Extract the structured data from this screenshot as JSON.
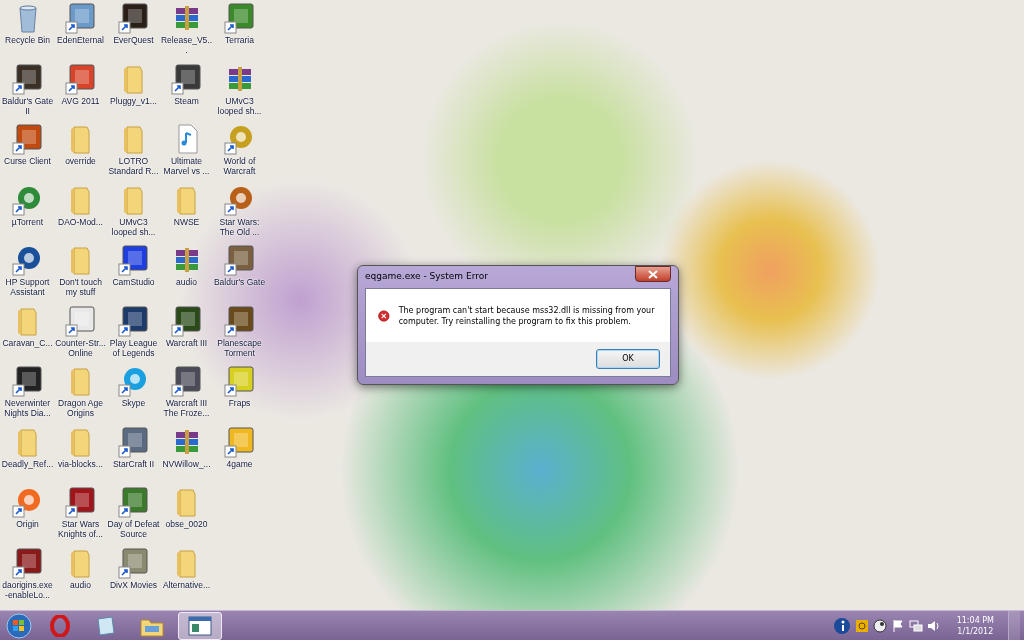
{
  "desktop_icons": [
    {
      "label": "Recycle Bin",
      "kind": "recycle",
      "shortcut": false,
      "color": "#9ab8d8"
    },
    {
      "label": "Baldur's Gate II",
      "kind": "app",
      "shortcut": true,
      "color": "#3a3026"
    },
    {
      "label": "Curse Client",
      "kind": "app",
      "shortcut": true,
      "color": "#c04a10"
    },
    {
      "label": "µTorrent",
      "kind": "round",
      "shortcut": true,
      "color": "#2e8b3a"
    },
    {
      "label": "HP Support Assistant",
      "kind": "round",
      "shortcut": true,
      "color": "#1a4f9a"
    },
    {
      "label": "Caravan_C...",
      "kind": "folder",
      "shortcut": false
    },
    {
      "label": "Neverwinter Nights Dia...",
      "kind": "app",
      "shortcut": true,
      "color": "#222222"
    },
    {
      "label": "Deadly_Ref...",
      "kind": "folder",
      "shortcut": false
    },
    {
      "label": "Origin",
      "kind": "round",
      "shortcut": true,
      "color": "#f06a22"
    },
    {
      "label": "daorigins.exe -enableLo...",
      "kind": "app",
      "shortcut": true,
      "color": "#8a1a1a"
    },
    {
      "label": "EdenEternal",
      "kind": "app",
      "shortcut": true,
      "color": "#6a9ac8"
    },
    {
      "label": "AVG 2011",
      "kind": "app",
      "shortcut": true,
      "color": "#d8442a"
    },
    {
      "label": "override",
      "kind": "folder",
      "shortcut": false
    },
    {
      "label": "DAO-Mod...",
      "kind": "folder",
      "shortcut": false
    },
    {
      "label": "Don't touch my stuff",
      "kind": "folder",
      "shortcut": false
    },
    {
      "label": "Counter-Str... Online",
      "kind": "app",
      "shortcut": true,
      "color": "#e8e8e8"
    },
    {
      "label": "Dragon Age Origins",
      "kind": "folder",
      "shortcut": false
    },
    {
      "label": "via-blocks...",
      "kind": "folder",
      "shortcut": false
    },
    {
      "label": "Star Wars Knights of...",
      "kind": "app",
      "shortcut": true,
      "color": "#a0141a"
    },
    {
      "label": "audio",
      "kind": "folder",
      "shortcut": false
    },
    {
      "label": "EverQuest",
      "kind": "app",
      "shortcut": true,
      "color": "#2a2018"
    },
    {
      "label": "Pluggy_v1...",
      "kind": "folder",
      "shortcut": false
    },
    {
      "label": "LOTRO Standard R...",
      "kind": "folder",
      "shortcut": false
    },
    {
      "label": "UMvC3 looped sh...",
      "kind": "folder",
      "shortcut": false
    },
    {
      "label": "CamStudio",
      "kind": "app",
      "shortcut": true,
      "color": "#1e3ee0"
    },
    {
      "label": "Play League of Legends",
      "kind": "app",
      "shortcut": true,
      "color": "#1c3a6a"
    },
    {
      "label": "Skype",
      "kind": "round",
      "shortcut": true,
      "color": "#1aa0e0"
    },
    {
      "label": "StarCraft II",
      "kind": "app",
      "shortcut": true,
      "color": "#5a6a80"
    },
    {
      "label": "Day of Defeat Source",
      "kind": "app",
      "shortcut": true,
      "color": "#3a7a2a"
    },
    {
      "label": "DivX Movies",
      "kind": "app",
      "shortcut": true,
      "color": "#8a8a70"
    },
    {
      "label": "Release_V5...",
      "kind": "archive",
      "shortcut": false
    },
    {
      "label": "Steam",
      "kind": "app",
      "shortcut": true,
      "color": "#3a3a3a"
    },
    {
      "label": "Ultimate Marvel vs ...",
      "kind": "music",
      "shortcut": false
    },
    {
      "label": "NWSE",
      "kind": "folder",
      "shortcut": false
    },
    {
      "label": "audio",
      "kind": "archive",
      "shortcut": false
    },
    {
      "label": "Warcraft III",
      "kind": "app",
      "shortcut": true,
      "color": "#2a4a1a"
    },
    {
      "label": "Warcraft III The Froze...",
      "kind": "app",
      "shortcut": true,
      "color": "#4a4a58"
    },
    {
      "label": "NVWillow_...",
      "kind": "archive",
      "shortcut": false
    },
    {
      "label": "obse_0020",
      "kind": "folder",
      "shortcut": false
    },
    {
      "label": "Alternative...",
      "kind": "folder",
      "shortcut": false
    },
    {
      "label": "Terraria",
      "kind": "app",
      "shortcut": true,
      "color": "#3a8a2a"
    },
    {
      "label": "UMvC3 looped sh...",
      "kind": "archive",
      "shortcut": false
    },
    {
      "label": "World of Warcraft",
      "kind": "round",
      "shortcut": true,
      "color": "#c8a020"
    },
    {
      "label": "Star Wars: The Old ...",
      "kind": "round",
      "shortcut": true,
      "color": "#b8601a"
    },
    {
      "label": "Baldur's Gate",
      "kind": "app",
      "shortcut": true,
      "color": "#7a6040"
    },
    {
      "label": "Planescape Torment",
      "kind": "app",
      "shortcut": true,
      "color": "#6a4a1a"
    },
    {
      "label": "Fraps",
      "kind": "app",
      "shortcut": true,
      "color": "#d8d020"
    },
    {
      "label": "4game",
      "kind": "app",
      "shortcut": true,
      "color": "#f0b820"
    }
  ],
  "dialog": {
    "title": "eqgame.exe - System Error",
    "message": "The program can't start because mss32.dll is missing from your computer. Try reinstalling the program to fix this problem.",
    "buttons": [
      {
        "label": "OK",
        "default": true
      }
    ]
  },
  "taskbar": {
    "items": [
      {
        "kind": "browser",
        "selected": false
      },
      {
        "kind": "notes",
        "selected": false
      },
      {
        "kind": "explorer",
        "selected": false
      },
      {
        "kind": "window",
        "selected": true
      }
    ],
    "tray": [
      {
        "kind": "info"
      },
      {
        "kind": "swirl"
      },
      {
        "kind": "steam"
      },
      {
        "kind": "flag"
      },
      {
        "kind": "network"
      },
      {
        "kind": "speaker"
      }
    ],
    "clock": {
      "time": "11:04 PM",
      "date": "1/1/2012"
    }
  }
}
